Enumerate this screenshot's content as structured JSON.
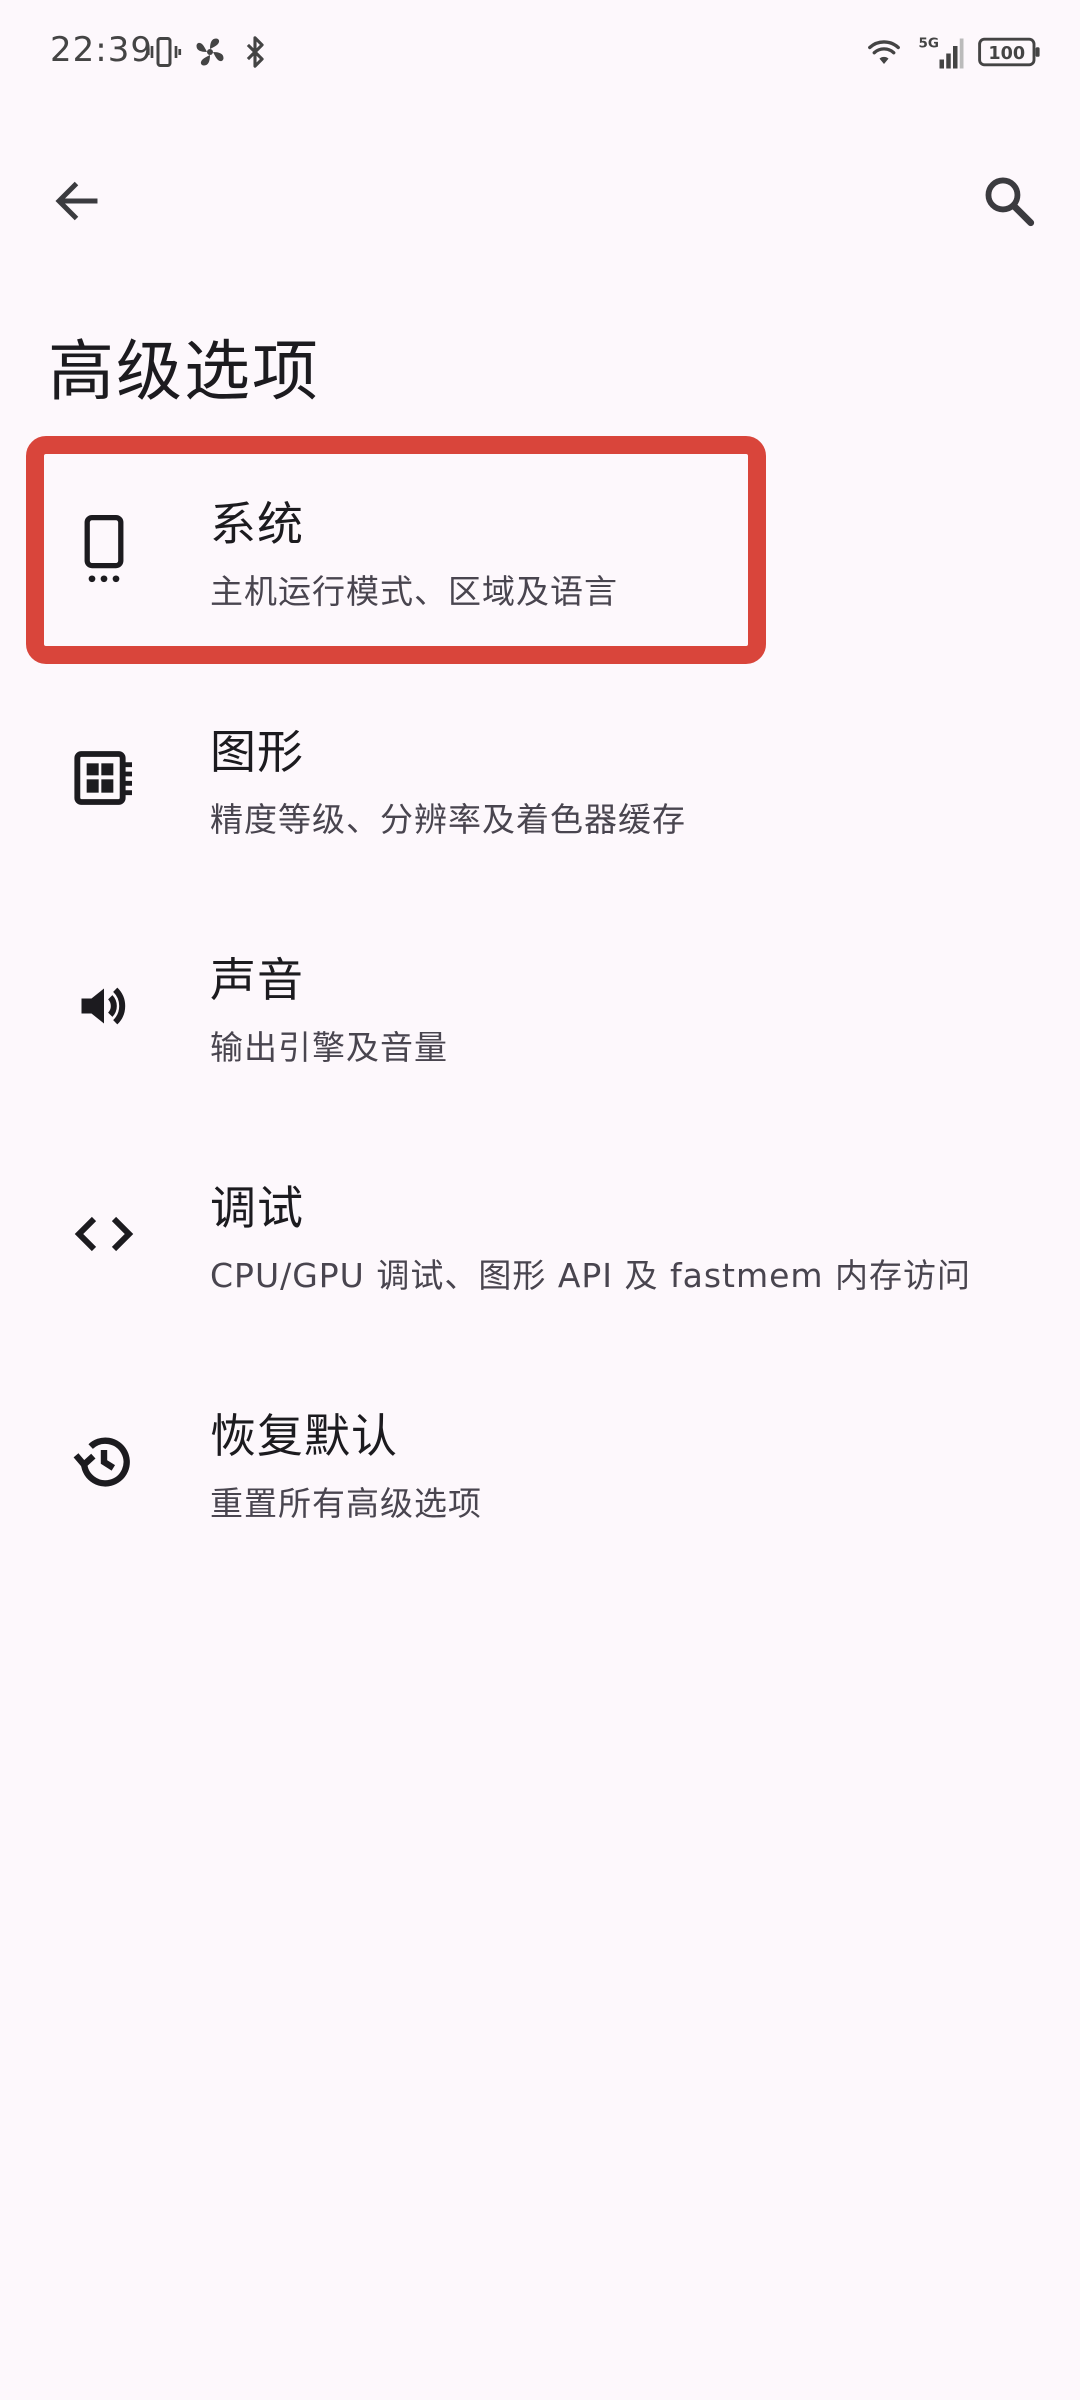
{
  "status_bar": {
    "time": "22:39",
    "network_label": "5G",
    "battery_level": "100"
  },
  "header": {
    "title": "高级选项"
  },
  "menu": {
    "items": [
      {
        "title": "系统",
        "subtitle": "主机运行模式、区域及语言",
        "icon": "phone-icon"
      },
      {
        "title": "图形",
        "subtitle": "精度等级、分辨率及着色器缓存",
        "icon": "chip-icon"
      },
      {
        "title": "声音",
        "subtitle": "输出引擎及音量",
        "icon": "speaker-icon"
      },
      {
        "title": "调试",
        "subtitle": "CPU/GPU 调试、图形 API 及 fastmem 内存访问",
        "icon": "code-icon"
      },
      {
        "title": "恢复默认",
        "subtitle": "重置所有高级选项",
        "icon": "history-icon"
      }
    ]
  },
  "colors": {
    "background": "#fdf8fc",
    "highlight": "#d9453b",
    "text_primary": "#1c1b1f",
    "text_secondary": "#49454f"
  }
}
